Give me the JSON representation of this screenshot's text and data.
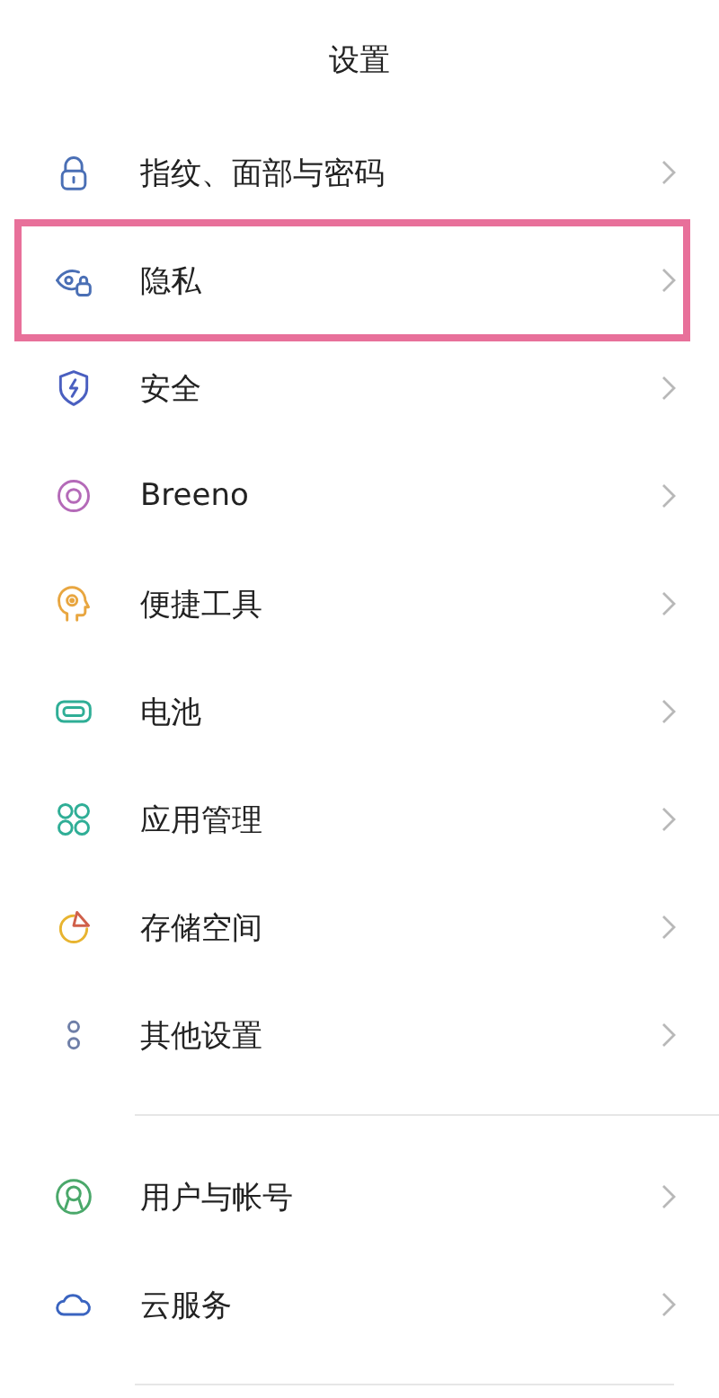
{
  "title": "设置",
  "sections": [
    {
      "items": [
        {
          "label": "指纹、面部与密码",
          "color": "#4a6fb5",
          "highlighted": false
        },
        {
          "label": "隐私",
          "color": "#4a6fb5",
          "highlighted": true
        },
        {
          "label": "安全",
          "color": "#4a5fc0",
          "highlighted": false
        },
        {
          "label": "Breeno",
          "color": "#b46ab8",
          "highlighted": false
        },
        {
          "label": "便捷工具",
          "color": "#e8a640",
          "highlighted": false
        },
        {
          "label": "电池",
          "color": "#2fae96",
          "highlighted": false
        },
        {
          "label": "应用管理",
          "color": "#2fae96",
          "highlighted": false
        },
        {
          "label": "存储空间",
          "color": "#e8b430",
          "highlighted": false
        },
        {
          "label": "其他设置",
          "color": "#6f7fa8",
          "highlighted": false
        }
      ]
    },
    {
      "items": [
        {
          "label": "用户与帐号",
          "color": "#4aa86a",
          "highlighted": false
        },
        {
          "label": "云服务",
          "color": "#3a64c0",
          "highlighted": false
        }
      ]
    }
  ]
}
